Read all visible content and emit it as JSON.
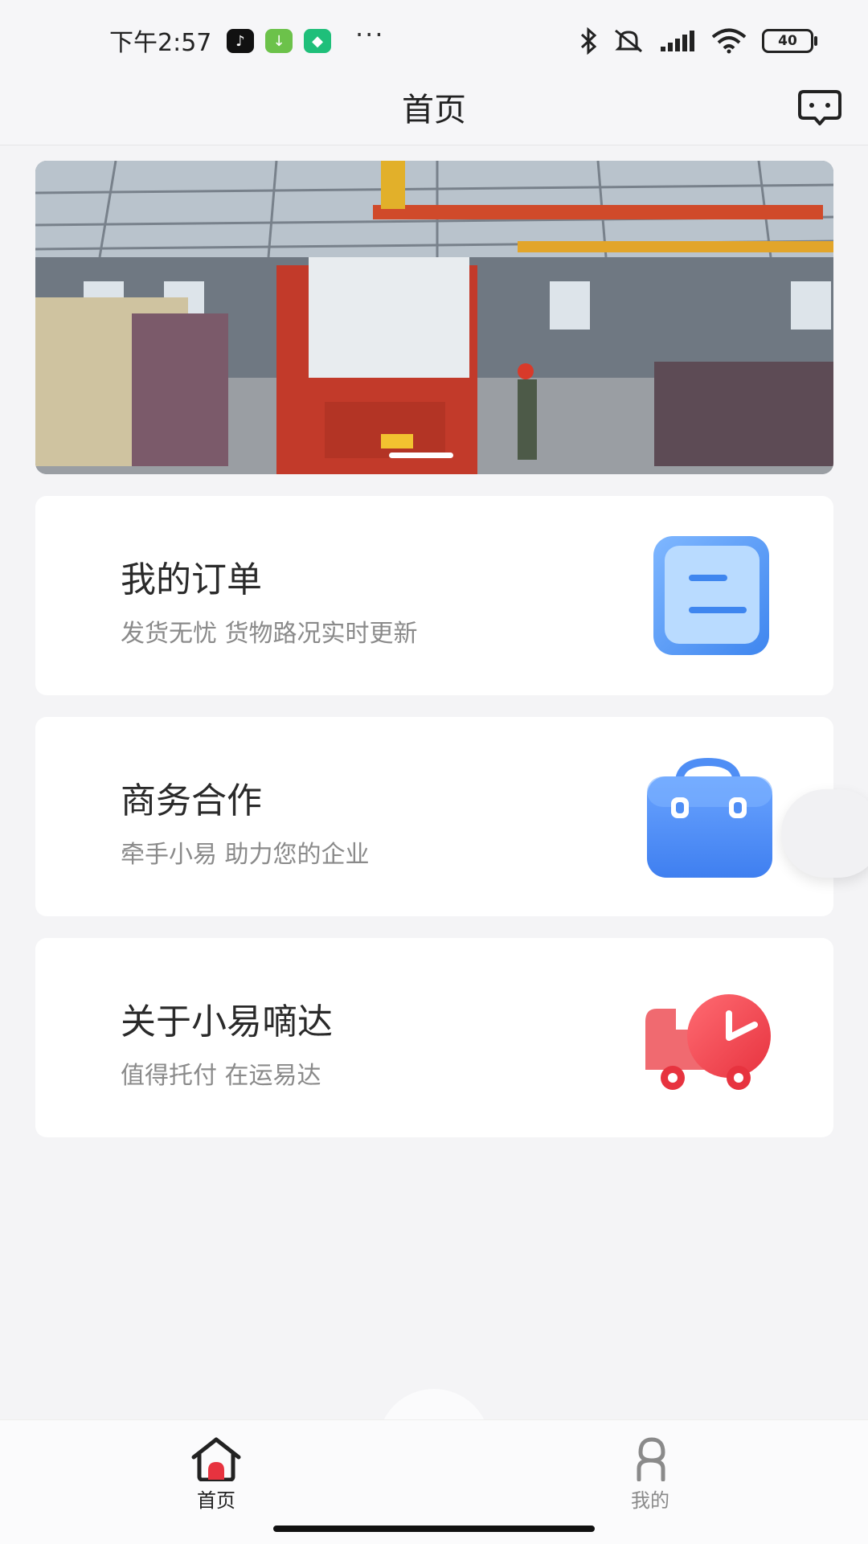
{
  "status_bar": {
    "time": "下午2:57",
    "battery": "40",
    "app_icons": [
      "tiktok-icon",
      "download-icon",
      "shield-icon"
    ],
    "system_icons": [
      "bluetooth-icon",
      "mute-icon",
      "signal-icon",
      "wifi-icon",
      "battery-icon"
    ]
  },
  "nav": {
    "title": "首页",
    "action_icon": "chat-icon"
  },
  "banner": {
    "image": "warehouse-crane-truck-photo",
    "active_slide": 1
  },
  "cards": [
    {
      "title": "我的订单",
      "subtitle": "发货无忧 货物路况实时更新",
      "icon": "order-list-icon"
    },
    {
      "title": "商务合作",
      "subtitle": "牵手小易 助力您的企业",
      "icon": "briefcase-icon"
    },
    {
      "title": "关于小易嘀达",
      "subtitle": "值得托付 在运易达",
      "icon": "delivery-truck-icon"
    }
  ],
  "tabbar": {
    "items": [
      {
        "label": "首页",
        "icon": "home-icon",
        "active": true
      },
      {
        "label": "我的",
        "icon": "profile-icon",
        "active": false
      }
    ]
  },
  "colors": {
    "tab_active": "#222222",
    "tab_inactive": "#8a8a8a",
    "accent_red": "#e7333f",
    "accent_blue": "#4f8ef5"
  }
}
